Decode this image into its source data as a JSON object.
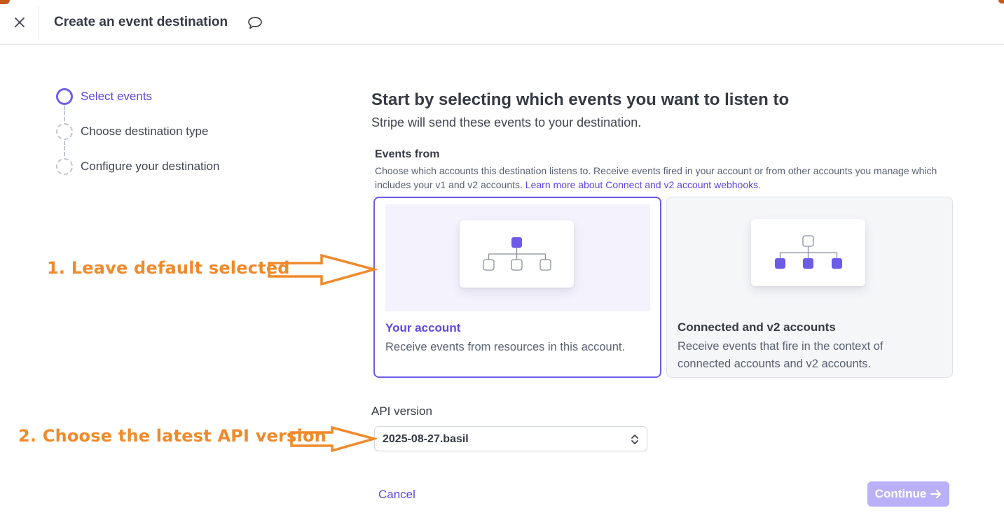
{
  "header": {
    "title": "Create an event destination",
    "close_icon": "close-icon",
    "feedback_icon": "speech-bubble-icon"
  },
  "stepper": {
    "steps": [
      {
        "label": "Select events",
        "state": "active"
      },
      {
        "label": "Choose destination type",
        "state": "pending"
      },
      {
        "label": "Configure your destination",
        "state": "pending"
      }
    ]
  },
  "main": {
    "heading": "Start by selecting which events you want to listen to",
    "subheading": "Stripe will send these events to your destination.",
    "events_from": {
      "label": "Events from",
      "description": "Choose which accounts this destination listens to. Receive events fired in your account or from other accounts you manage which includes your v1 and v2 accounts.",
      "link_text": "Learn more about Connect and v2 account webhooks."
    },
    "cards": [
      {
        "title": "Your account",
        "description": "Receive events from resources in this account.",
        "selected": true
      },
      {
        "title": "Connected and v2 accounts",
        "description": "Receive events that fire in the context of connected accounts and v2 accounts.",
        "selected": false
      }
    ],
    "api_version": {
      "label": "API version",
      "value": "2025-08-27.basil"
    },
    "footer": {
      "cancel_label": "Cancel",
      "continue_label": "Continue"
    }
  },
  "annotations": {
    "first": "1. Leave default selected",
    "second": "2. Choose the latest API version"
  },
  "colors": {
    "accent": "#6c5ce7",
    "annotation": "#ef8a2b",
    "continue_disabled": "#b9b0f8"
  }
}
